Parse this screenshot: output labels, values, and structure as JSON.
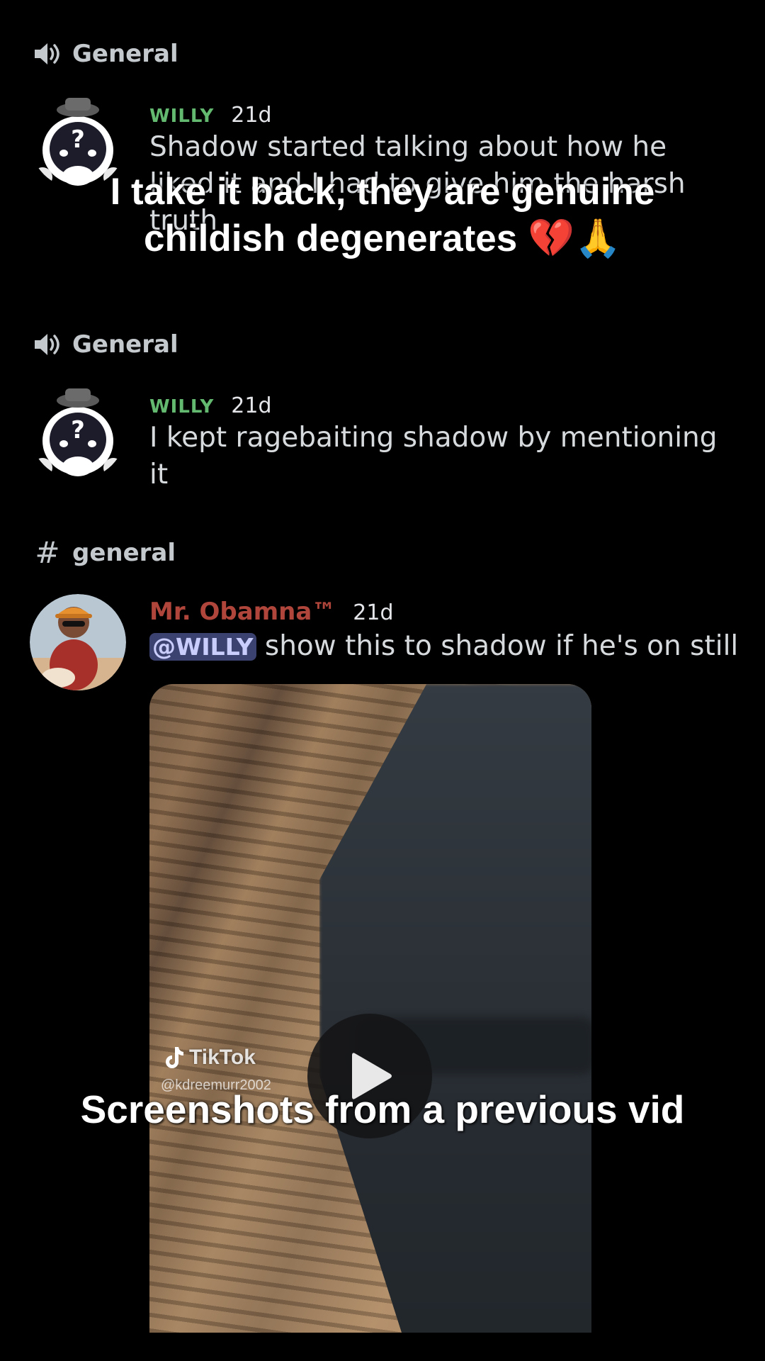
{
  "overlay": {
    "caption_top_line1": "I take it back, they are genuine",
    "caption_top_line2": "childish degenerates 💔🙏",
    "caption_bottom": "Screenshots from a previous vid"
  },
  "sections": [
    {
      "channel": {
        "icon": "speaker-icon",
        "name": "General"
      },
      "message": {
        "username": "WILLY",
        "timestamp": "21d",
        "text": "Shadow started talking about how he liked it and I had to give him the harsh truth"
      }
    },
    {
      "channel": {
        "icon": "speaker-icon",
        "name": "General"
      },
      "message": {
        "username": "WILLY",
        "timestamp": "21d",
        "text": "I kept ragebaiting shadow by mentioning it"
      }
    },
    {
      "channel": {
        "icon": "hash-icon",
        "name": "general"
      },
      "message": {
        "username": "Mr. Obamna™",
        "timestamp": "21d",
        "mention": "@WILLY",
        "text": " show this to shadow if he's on still"
      }
    }
  ],
  "video": {
    "watermark_brand": "TikTok",
    "watermark_handle": "@kdreemurr2002"
  },
  "colors": {
    "background": "#000000",
    "willy_name": "#63b96f",
    "obamna_name": "#b0463b",
    "mention_bg": "#3c4270"
  }
}
